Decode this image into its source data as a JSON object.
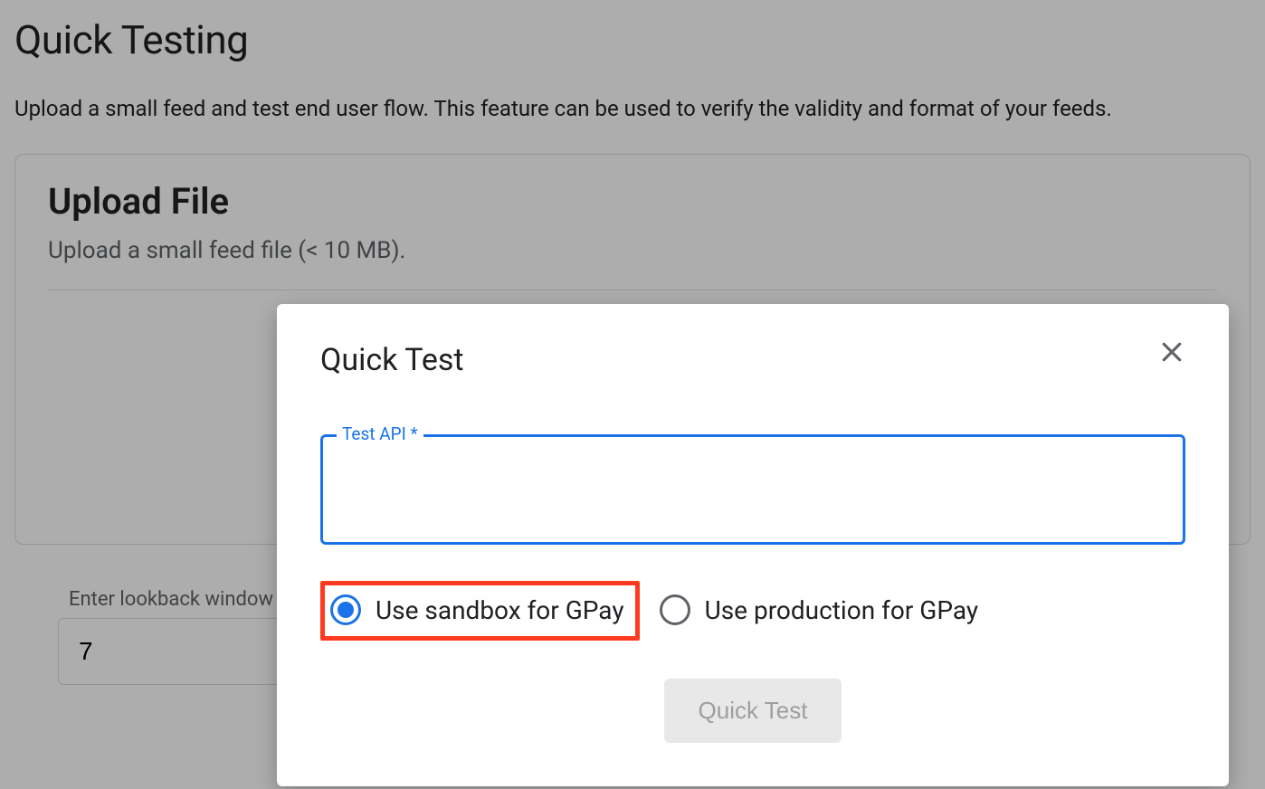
{
  "page": {
    "title": "Quick Testing",
    "description": "Upload a small feed and test end user flow. This feature can be used to verify the validity and format of your feeds."
  },
  "card": {
    "title": "Upload File",
    "description": "Upload a small feed file (< 10 MB)."
  },
  "lookback": {
    "label": "Enter lookback window",
    "value": "7"
  },
  "modal": {
    "title": "Quick Test",
    "field_label": "Test API *",
    "field_value": "",
    "radio_sandbox": "Use sandbox for GPay",
    "radio_production": "Use production for GPay",
    "submit_label": "Quick Test"
  }
}
